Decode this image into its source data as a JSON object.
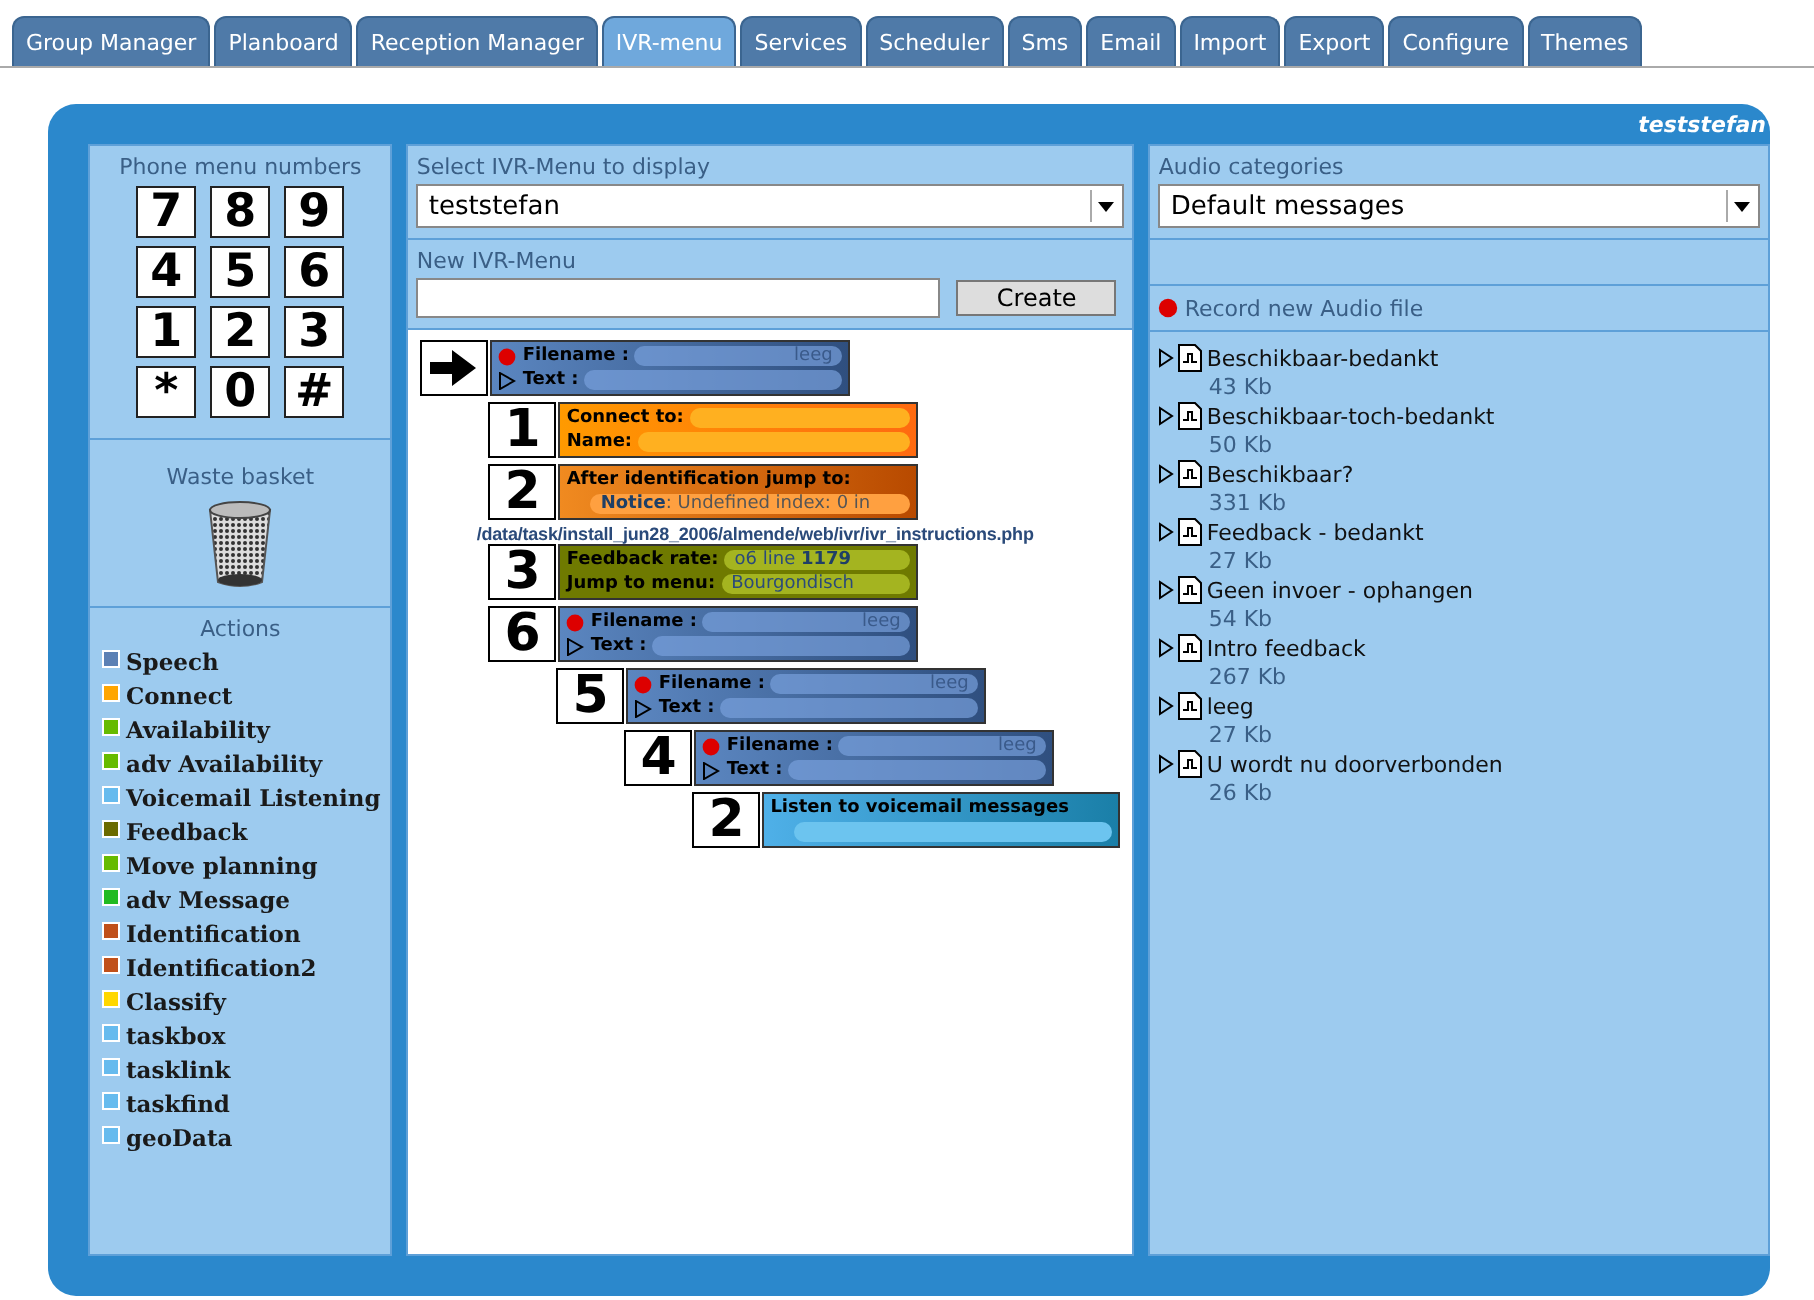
{
  "tabs": [
    {
      "label": "Group Manager",
      "selected": false
    },
    {
      "label": "Planboard",
      "selected": false
    },
    {
      "label": "Reception Manager",
      "selected": false
    },
    {
      "label": "IVR-menu",
      "selected": true
    },
    {
      "label": "Services",
      "selected": false
    },
    {
      "label": "Scheduler",
      "selected": false
    },
    {
      "label": "Sms",
      "selected": false
    },
    {
      "label": "Email",
      "selected": false
    },
    {
      "label": "Import",
      "selected": false
    },
    {
      "label": "Export",
      "selected": false
    },
    {
      "label": "Configure",
      "selected": false
    },
    {
      "label": "Themes",
      "selected": false
    }
  ],
  "user": "teststefan",
  "left": {
    "keypad_title": "Phone menu numbers",
    "keys": [
      "7",
      "8",
      "9",
      "4",
      "5",
      "6",
      "1",
      "2",
      "3",
      "*",
      "0",
      "#"
    ],
    "waste_title": "Waste basket",
    "actions_title": "Actions",
    "actions": [
      {
        "label": "Speech",
        "color": "#5b80b4"
      },
      {
        "label": "Connect",
        "color": "#ffa500"
      },
      {
        "label": "Availability",
        "color": "#66bb00"
      },
      {
        "label": "adv Availability",
        "color": "#66bb00"
      },
      {
        "label": "Voicemail Listening",
        "color": "#66bbee"
      },
      {
        "label": "Feedback",
        "color": "#6b6b00"
      },
      {
        "label": "Move planning",
        "color": "#66bb00"
      },
      {
        "label": "adv Message",
        "color": "#22bb22"
      },
      {
        "label": "Identification",
        "color": "#c0501a"
      },
      {
        "label": "Identification2",
        "color": "#c0501a"
      },
      {
        "label": "Classify",
        "color": "#ffd700"
      },
      {
        "label": "taskbox",
        "color": "#66bbee"
      },
      {
        "label": "tasklink",
        "color": "#66bbee"
      },
      {
        "label": "taskfind",
        "color": "#66bbee"
      },
      {
        "label": "geoData",
        "color": "#66bbee"
      }
    ]
  },
  "middle": {
    "select_label": "Select IVR-Menu to display",
    "select_value": "teststefan",
    "new_label": "New IVR-Menu",
    "create_button": "Create",
    "tree": {
      "kind": "audio",
      "lines": [
        {
          "kind": "field",
          "label": "Filename :",
          "value": "leeg"
        },
        {
          "kind": "field",
          "label": "Text :"
        }
      ],
      "children": [
        {
          "key": "1",
          "kind": "connect",
          "lines": [
            {
              "kind": "field",
              "label": "Connect to:"
            },
            {
              "kind": "field",
              "label": "Name:"
            }
          ]
        },
        {
          "key": "2",
          "kind": "identification",
          "lines": [
            {
              "kind": "heading",
              "label": "After identification jump to:"
            },
            {
              "kind": "indented",
              "value": "**Notice**: Undefined index: 0 in"
            }
          ],
          "notice_path": "/data/task/install_jun28_2006/almende/web/ivr/ivr_instructions.php"
        },
        {
          "key": "3",
          "kind": "feedback",
          "lines": [
            {
              "kind": "field",
              "label": "Feedback rate:",
              "value": "o6 line **1179**"
            },
            {
              "kind": "field",
              "label": "Jump to menu:",
              "value": "Bourgondisch"
            }
          ]
        },
        {
          "key": "6",
          "kind": "audio",
          "lines": [
            {
              "kind": "field",
              "label": "Filename :",
              "value": "leeg"
            },
            {
              "kind": "field",
              "label": "Text :"
            }
          ],
          "children": [
            {
              "key": "5",
              "kind": "audio",
              "lines": [
                {
                  "kind": "field",
                  "label": "Filename :",
                  "value": "leeg"
                },
                {
                  "kind": "field",
                  "label": "Text :"
                }
              ],
              "children": [
                {
                  "key": "4",
                  "kind": "audio",
                  "lines": [
                    {
                      "kind": "field",
                      "label": "Filename :",
                      "value": "leeg"
                    },
                    {
                      "kind": "field",
                      "label": "Text :"
                    }
                  ],
                  "children": [
                    {
                      "key": "2",
                      "kind": "voicemail",
                      "lines": [
                        {
                          "kind": "heading",
                          "label": "Listen to voicemail messages"
                        },
                        {
                          "kind": "indented"
                        }
                      ]
                    }
                  ]
                }
              ]
            }
          ]
        }
      ]
    }
  },
  "right": {
    "select_label": "Audio categories",
    "select_value": "Default messages",
    "record_label": "Record new Audio file",
    "files": [
      {
        "name": "Beschikbaar-bedankt",
        "size": "43 Kb"
      },
      {
        "name": "Beschikbaar-toch-bedankt",
        "size": "50 Kb"
      },
      {
        "name": "Beschikbaar?",
        "size": "331 Kb"
      },
      {
        "name": "Feedback - bedankt",
        "size": "27 Kb"
      },
      {
        "name": "Geen invoer - ophangen",
        "size": "54 Kb"
      },
      {
        "name": "Intro feedback",
        "size": "267 Kb"
      },
      {
        "name": "leeg",
        "size": "27 Kb"
      },
      {
        "name": "U wordt nu doorverbonden",
        "size": "26 Kb"
      }
    ]
  }
}
